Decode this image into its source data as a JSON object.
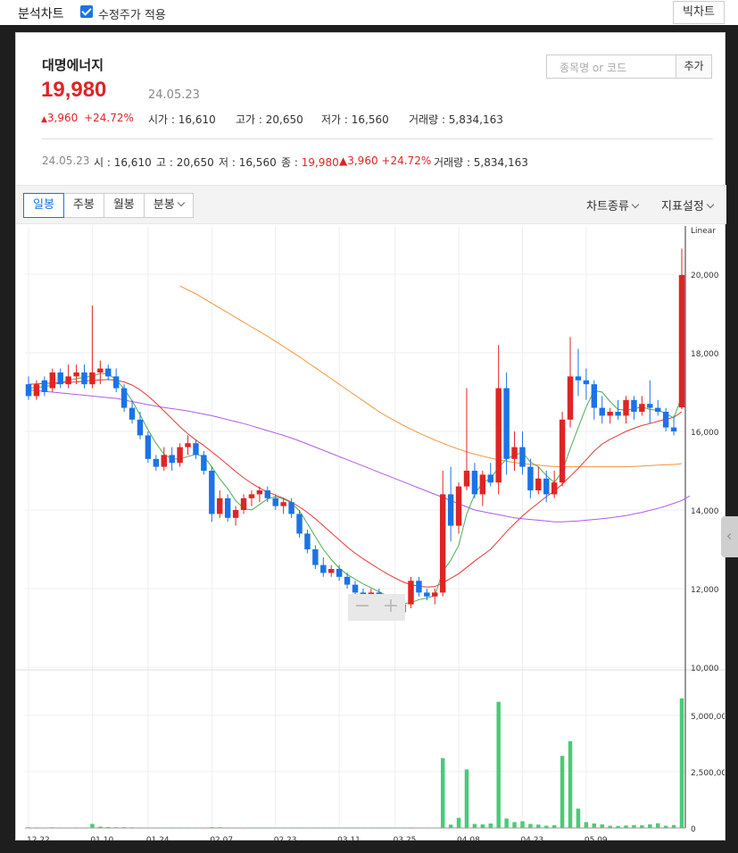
{
  "topbar": {
    "title": "분석차트",
    "adjusted_label": "수정주가 적용",
    "big_chart_label": "빅차트"
  },
  "stock": {
    "name": "대명에너지",
    "price": "19,980",
    "date": "24.05.23",
    "change_abs": "3,960",
    "change_pct": "+24.72%",
    "open_label": "시가",
    "open": "16,610",
    "high_label": "고가",
    "high": "20,650",
    "low_label": "저가",
    "low": "16,560",
    "volume_label": "거래량",
    "volume": "5,834,163"
  },
  "search": {
    "placeholder": "종목명 or 코드",
    "add_label": "추가"
  },
  "summary": {
    "date": "24.05.23",
    "o_label": "시",
    "o": "16,610",
    "h_label": "고",
    "h": "20,650",
    "l_label": "저",
    "l": "16,560",
    "c_label": "종",
    "c": "19,980",
    "change_abs": "3,960",
    "change_pct": "+24.72%",
    "v_label": "거래량",
    "v": "5,834,163"
  },
  "toolbar": {
    "tabs": [
      "일봉",
      "주봉",
      "월봉",
      "분봉"
    ],
    "active_tab": "일봉",
    "chart_type_label": "차트종류",
    "indicator_label": "지표설정"
  },
  "colors": {
    "up": "#e02424",
    "down": "#1a73e8",
    "ma5": "#4caf50",
    "ma20": "#e53935",
    "ma60": "#b05ce6",
    "ma120": "#f0953c",
    "volume": "#4cc97a"
  },
  "chart_data": {
    "type": "candlestick",
    "scale_label": "Linear",
    "y_ticks": [
      "20,000",
      "18,000",
      "16,000",
      "14,000",
      "12,000",
      "10,000"
    ],
    "y_tick_values": [
      20000,
      18000,
      16000,
      14000,
      12000,
      10000
    ],
    "volume_ticks": [
      "5,000,000",
      "2,500,000",
      "0"
    ],
    "volume_tick_values": [
      5000000,
      2500000,
      0
    ],
    "x_labels": [
      "12.22",
      "01.10",
      "01.24",
      "02.07",
      "02.23",
      "03.11",
      "03.25",
      "04.08",
      "04.23",
      "05.09"
    ],
    "ylim": [
      10000,
      21000
    ],
    "volume_ylim": [
      0,
      6500000
    ],
    "candles": [
      [
        17200,
        17400,
        16800,
        16900
      ],
      [
        16900,
        17300,
        16800,
        17200
      ],
      [
        17300,
        17400,
        16900,
        17000
      ],
      [
        17100,
        17600,
        17000,
        17500
      ],
      [
        17500,
        17600,
        17100,
        17200
      ],
      [
        17200,
        17700,
        17100,
        17400
      ],
      [
        17400,
        17700,
        17200,
        17500
      ],
      [
        17500,
        17700,
        17100,
        17200
      ],
      [
        17200,
        19200,
        17100,
        17500
      ],
      [
        17500,
        17800,
        17200,
        17600
      ],
      [
        17600,
        17700,
        17300,
        17400
      ],
      [
        17400,
        17600,
        17000,
        17100
      ],
      [
        17100,
        17200,
        16500,
        16600
      ],
      [
        16600,
        16800,
        16200,
        16300
      ],
      [
        16300,
        16500,
        15800,
        15900
      ],
      [
        15900,
        16000,
        15200,
        15300
      ],
      [
        15300,
        15400,
        15000,
        15100
      ],
      [
        15100,
        15600,
        15000,
        15400
      ],
      [
        15400,
        15600,
        15000,
        15200
      ],
      [
        15200,
        15700,
        15100,
        15600
      ],
      [
        15600,
        15900,
        15400,
        15700
      ],
      [
        15700,
        15800,
        15300,
        15400
      ],
      [
        15400,
        15500,
        14900,
        15000
      ],
      [
        15000,
        15100,
        13700,
        13900
      ],
      [
        13900,
        14500,
        13800,
        14300
      ],
      [
        14300,
        14400,
        13700,
        13800
      ],
      [
        13800,
        14100,
        13600,
        14000
      ],
      [
        14000,
        14400,
        13900,
        14300
      ],
      [
        14300,
        14500,
        14100,
        14400
      ],
      [
        14400,
        14600,
        14200,
        14500
      ],
      [
        14500,
        14600,
        14200,
        14300
      ],
      [
        14300,
        14400,
        14000,
        14100
      ],
      [
        14100,
        14300,
        13900,
        14200
      ],
      [
        14200,
        14300,
        13800,
        13900
      ],
      [
        13900,
        14000,
        13300,
        13400
      ],
      [
        13400,
        13500,
        12900,
        13000
      ],
      [
        13000,
        13100,
        12500,
        12600
      ],
      [
        12600,
        12800,
        12300,
        12400
      ],
      [
        12400,
        12600,
        12300,
        12500
      ],
      [
        12500,
        12600,
        12200,
        12300
      ],
      [
        12300,
        12400,
        12000,
        12100
      ],
      [
        12100,
        12200,
        11800,
        11900
      ],
      [
        11900,
        12000,
        11700,
        11800
      ],
      [
        11800,
        12000,
        11600,
        11900
      ],
      [
        11900,
        12000,
        11600,
        11700
      ],
      [
        11700,
        11800,
        11400,
        11500
      ],
      [
        11500,
        11700,
        11300,
        11400
      ],
      [
        11400,
        11700,
        11300,
        11600
      ],
      [
        11600,
        12300,
        11500,
        12200
      ],
      [
        12200,
        12300,
        11800,
        11900
      ],
      [
        11900,
        12000,
        11700,
        11800
      ],
      [
        11800,
        12000,
        11600,
        11900
      ],
      [
        11900,
        15000,
        11800,
        14400
      ],
      [
        14400,
        15100,
        13200,
        13600
      ],
      [
        13600,
        14700,
        13400,
        14600
      ],
      [
        14600,
        17100,
        14500,
        15000
      ],
      [
        15000,
        15200,
        14300,
        14400
      ],
      [
        14400,
        15000,
        14100,
        14900
      ],
      [
        14900,
        15200,
        14600,
        14700
      ],
      [
        14700,
        18200,
        14400,
        17100
      ],
      [
        17100,
        17500,
        14900,
        15300
      ],
      [
        15300,
        16000,
        15000,
        15600
      ],
      [
        15600,
        16000,
        14900,
        15100
      ],
      [
        15100,
        15300,
        14300,
        14500
      ],
      [
        14500,
        15100,
        14400,
        14800
      ],
      [
        14800,
        15000,
        14200,
        14400
      ],
      [
        14400,
        15000,
        14300,
        14700
      ],
      [
        14700,
        16500,
        14600,
        16300
      ],
      [
        16300,
        18400,
        16100,
        17400
      ],
      [
        17400,
        18100,
        16900,
        17300
      ],
      [
        17300,
        17600,
        16800,
        17200
      ],
      [
        17200,
        17300,
        16300,
        16600
      ],
      [
        16600,
        16900,
        16200,
        16400
      ],
      [
        16400,
        16600,
        16200,
        16500
      ],
      [
        16500,
        16800,
        16300,
        16400
      ],
      [
        16400,
        16900,
        16200,
        16800
      ],
      [
        16800,
        16900,
        16300,
        16500
      ],
      [
        16500,
        16900,
        16400,
        16700
      ],
      [
        16700,
        17300,
        16200,
        16600
      ],
      [
        16600,
        16800,
        16400,
        16500
      ],
      [
        16500,
        16600,
        16000,
        16100
      ],
      [
        16100,
        16400,
        15900,
        16000
      ],
      [
        16610,
        20650,
        16560,
        19980
      ]
    ],
    "volumes": [
      30000,
      25000,
      20000,
      28000,
      22000,
      18000,
      25000,
      20000,
      180000,
      60000,
      40000,
      30000,
      35000,
      28000,
      22000,
      20000,
      18000,
      15000,
      16000,
      14000,
      15000,
      13000,
      20000,
      35000,
      30000,
      22000,
      18000,
      20000,
      15000,
      17000,
      14000,
      12000,
      13000,
      15000,
      14000,
      18000,
      16000,
      14000,
      12000,
      13000,
      11000,
      12000,
      10000,
      11000,
      12000,
      14000,
      15000,
      13000,
      25000,
      20000,
      18000,
      16000,
      3100000,
      150000,
      450000,
      2600000,
      180000,
      160000,
      200000,
      5600000,
      420000,
      260000,
      300000,
      180000,
      150000,
      100000,
      120000,
      3200000,
      3850000,
      860000,
      260000,
      200000,
      160000,
      100000,
      90000,
      110000,
      130000,
      120000,
      160000,
      210000,
      100000,
      130000,
      5750000
    ],
    "ma5": [
      17100,
      17120,
      17140,
      17180,
      17240,
      17300,
      17340,
      17380,
      17400,
      17480,
      17460,
      17320,
      17080,
      16780,
      16420,
      16040,
      15700,
      15420,
      15300,
      15300,
      15360,
      15420,
      15360,
      15100,
      14800,
      14540,
      14240,
      14040,
      14000,
      14140,
      14280,
      14340,
      14280,
      14180,
      13980,
      13660,
      13320,
      13000,
      12740,
      12520,
      12360,
      12240,
      12120,
      12020,
      11920,
      11820,
      11700,
      11620,
      11640,
      11720,
      11760,
      11820,
      12440,
      12720,
      13100,
      13900,
      14400,
      14700,
      14800,
      15080,
      15300,
      15400,
      15460,
      15220,
      15100,
      14880,
      14700,
      14980,
      15560,
      16100,
      16620,
      17040,
      17000,
      16760,
      16560,
      16540,
      16580,
      16620,
      16560,
      16540,
      16460,
      16340,
      16900
    ],
    "ma20": [
      17200,
      17210,
      17220,
      17230,
      17240,
      17250,
      17260,
      17280,
      17300,
      17310,
      17320,
      17300,
      17260,
      17180,
      17060,
      16900,
      16720,
      16520,
      16320,
      16120,
      15940,
      15780,
      15640,
      15480,
      15320,
      15150,
      14980,
      14820,
      14680,
      14560,
      14460,
      14380,
      14300,
      14200,
      14080,
      13940,
      13780,
      13600,
      13420,
      13240,
      13060,
      12900,
      12760,
      12630,
      12500,
      12380,
      12270,
      12170,
      12100,
      12060,
      12040,
      12050,
      12150,
      12260,
      12380,
      12540,
      12700,
      12850,
      13000,
      13220,
      13450,
      13650,
      13850,
      14020,
      14180,
      14340,
      14480,
      14660,
      14860,
      15060,
      15280,
      15500,
      15680,
      15800,
      15900,
      16000,
      16080,
      16150,
      16200,
      16260,
      16310,
      16360,
      16500
    ],
    "ma60": [
      17050,
      17040,
      17020,
      17000,
      16980,
      16960,
      16940,
      16920,
      16900,
      16880,
      16860,
      16840,
      16800,
      16760,
      16720,
      16680,
      16640,
      16610,
      16580,
      16550,
      16520,
      16480,
      16440,
      16400,
      16350,
      16300,
      16250,
      16200,
      16140,
      16080,
      16020,
      15960,
      15900,
      15830,
      15760,
      15680,
      15600,
      15520,
      15440,
      15360,
      15280,
      15200,
      15120,
      15040,
      14960,
      14880,
      14800,
      14720,
      14640,
      14560,
      14480,
      14400,
      14320,
      14240,
      14160,
      14080,
      14000,
      13960,
      13920,
      13880,
      13840,
      13800,
      13780,
      13760,
      13740,
      13720,
      13700,
      13700,
      13710,
      13720,
      13740,
      13760,
      13780,
      13800,
      13830,
      13860,
      13900,
      13940,
      13990,
      14040,
      14100,
      14170,
      14240,
      14360
    ],
    "ma120_start_index": 19,
    "ma120": [
      19700,
      19600,
      19500,
      19380,
      19260,
      19140,
      19020,
      18900,
      18780,
      18660,
      18540,
      18420,
      18290,
      18160,
      18030,
      17900,
      17760,
      17620,
      17480,
      17340,
      17200,
      17060,
      16920,
      16780,
      16640,
      16500,
      16380,
      16270,
      16160,
      16060,
      15960,
      15870,
      15780,
      15700,
      15620,
      15550,
      15480,
      15420,
      15370,
      15320,
      15280,
      15240,
      15210,
      15180,
      15160,
      15140,
      15120,
      15110,
      15100,
      15100,
      15100,
      15100,
      15100,
      15100,
      15100,
      15100,
      15100,
      15110,
      15120,
      15130,
      15140,
      15150,
      15160,
      15180
    ]
  }
}
